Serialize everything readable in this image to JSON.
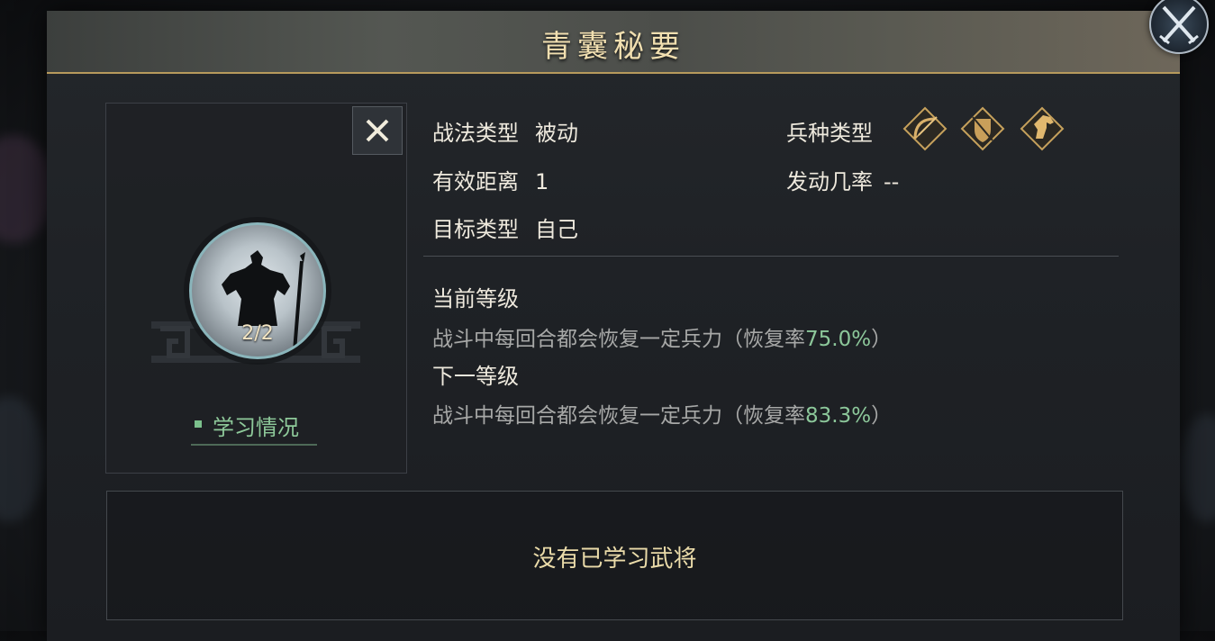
{
  "dialog": {
    "title": "青囊秘要"
  },
  "skill": {
    "level": "2/2",
    "study_label": "学习情况"
  },
  "attributes": {
    "type_label": "战法类型",
    "type_value": "被动",
    "range_label": "有效距离",
    "range_value": "1",
    "target_label": "目标类型",
    "target_value": "自己",
    "troop_label": "兵种类型",
    "troop_icons": [
      "bow-archer-icon",
      "shield-infantry-icon",
      "horse-cavalry-icon"
    ],
    "trigger_label": "发动几率",
    "trigger_value": "--"
  },
  "levels": {
    "current_heading": "当前等级",
    "current_desc_prefix": "战斗中每回合都会恢复一定兵力（恢复率",
    "current_rate": "75.0%",
    "current_desc_suffix": "）",
    "next_heading": "下一等级",
    "next_desc_prefix": "战斗中每回合都会恢复一定兵力（恢复率",
    "next_rate": "83.3%",
    "next_desc_suffix": "）"
  },
  "generals": {
    "empty_text": "没有已学习武将"
  },
  "colors": {
    "title_gold": "#f1dfb0",
    "highlight_green": "#8cc79a",
    "frame_gold": "#b79a5c"
  }
}
